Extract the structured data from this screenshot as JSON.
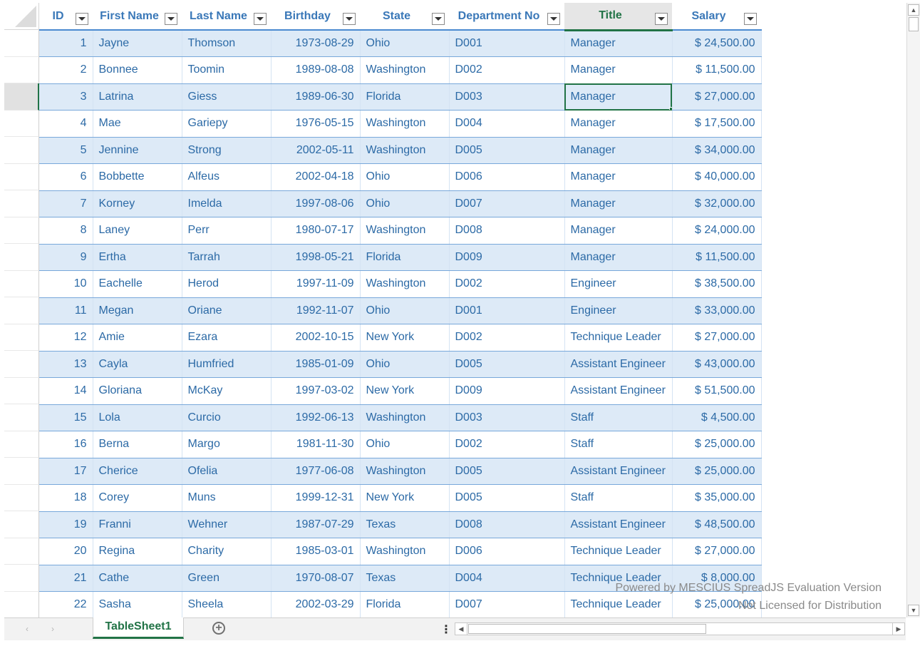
{
  "table": {
    "columns": [
      {
        "key": "id",
        "label": "ID"
      },
      {
        "key": "first",
        "label": "First Name"
      },
      {
        "key": "last",
        "label": "Last Name"
      },
      {
        "key": "birthday",
        "label": "Birthday"
      },
      {
        "key": "state",
        "label": "State"
      },
      {
        "key": "dept",
        "label": "Department No"
      },
      {
        "key": "title",
        "label": "Title"
      },
      {
        "key": "salary",
        "label": "Salary"
      }
    ],
    "active_column": "Title",
    "selected_cell": {
      "row": 3,
      "column": "Title"
    },
    "rows": [
      [
        "1",
        "Jayne",
        "Thomson",
        "1973-08-29",
        "Ohio",
        "D001",
        "Manager",
        "$ 24,500.00"
      ],
      [
        "2",
        "Bonnee",
        "Toomin",
        "1989-08-08",
        "Washington",
        "D002",
        "Manager",
        "$ 11,500.00"
      ],
      [
        "3",
        "Latrina",
        "Giess",
        "1989-06-30",
        "Florida",
        "D003",
        "Manager",
        "$ 27,000.00"
      ],
      [
        "4",
        "Mae",
        "Gariepy",
        "1976-05-15",
        "Washington",
        "D004",
        "Manager",
        "$ 17,500.00"
      ],
      [
        "5",
        "Jennine",
        "Strong",
        "2002-05-11",
        "Washington",
        "D005",
        "Manager",
        "$ 34,000.00"
      ],
      [
        "6",
        "Bobbette",
        "Alfeus",
        "2002-04-18",
        "Ohio",
        "D006",
        "Manager",
        "$ 40,000.00"
      ],
      [
        "7",
        "Korney",
        "Imelda",
        "1997-08-06",
        "Ohio",
        "D007",
        "Manager",
        "$ 32,000.00"
      ],
      [
        "8",
        "Laney",
        "Perr",
        "1980-07-17",
        "Washington",
        "D008",
        "Manager",
        "$ 24,000.00"
      ],
      [
        "9",
        "Ertha",
        "Tarrah",
        "1998-05-21",
        "Florida",
        "D009",
        "Manager",
        "$ 11,500.00"
      ],
      [
        "10",
        "Eachelle",
        "Herod",
        "1997-11-09",
        "Washington",
        "D002",
        "Engineer",
        "$ 38,500.00"
      ],
      [
        "11",
        "Megan",
        "Oriane",
        "1992-11-07",
        "Ohio",
        "D001",
        "Engineer",
        "$ 33,000.00"
      ],
      [
        "12",
        "Amie",
        "Ezara",
        "2002-10-15",
        "New York",
        "D002",
        "Technique Leader",
        "$ 27,000.00"
      ],
      [
        "13",
        "Cayla",
        "Humfried",
        "1985-01-09",
        "Ohio",
        "D005",
        "Assistant Engineer",
        "$ 43,000.00"
      ],
      [
        "14",
        "Gloriana",
        "McKay",
        "1997-03-02",
        "New York",
        "D009",
        "Assistant Engineer",
        "$ 51,500.00"
      ],
      [
        "15",
        "Lola",
        "Curcio",
        "1992-06-13",
        "Washington",
        "D003",
        "Staff",
        "$ 4,500.00"
      ],
      [
        "16",
        "Berna",
        "Margo",
        "1981-11-30",
        "Ohio",
        "D002",
        "Staff",
        "$ 25,000.00"
      ],
      [
        "17",
        "Cherice",
        "Ofelia",
        "1977-06-08",
        "Washington",
        "D005",
        "Assistant Engineer",
        "$ 25,000.00"
      ],
      [
        "18",
        "Corey",
        "Muns",
        "1999-12-31",
        "New York",
        "D005",
        "Staff",
        "$ 35,000.00"
      ],
      [
        "19",
        "Franni",
        "Wehner",
        "1987-07-29",
        "Texas",
        "D008",
        "Assistant Engineer",
        "$ 48,500.00"
      ],
      [
        "20",
        "Regina",
        "Charity",
        "1985-03-01",
        "Washington",
        "D006",
        "Technique Leader",
        "$ 27,000.00"
      ],
      [
        "21",
        "Cathe",
        "Green",
        "1970-08-07",
        "Texas",
        "D004",
        "Technique Leader",
        "$ 8,000.00"
      ],
      [
        "22",
        "Sasha",
        "Sheela",
        "2002-03-29",
        "Florida",
        "D007",
        "Technique Leader",
        "$ 25,000.00"
      ]
    ]
  },
  "watermark": {
    "line1": "Powered by MESCIUS SpreadJS Evaluation Version",
    "line2": "Not Licensed for Distribution"
  },
  "tabbar": {
    "sheet_tab": "TableSheet1",
    "nav_prev_icon": "‹",
    "nav_next_icon": "›",
    "add_icon": "+",
    "splitter_icon": "⋮"
  },
  "icons": {
    "filter": "filter-dropdown-icon",
    "add_sheet": "plus-circle-icon",
    "scroll_up": "▲",
    "scroll_down": "▼",
    "scroll_left": "◀",
    "scroll_right": "▶"
  },
  "colors": {
    "accent_green": "#217346",
    "band_blue": "#ddeaf7",
    "header_text_blue": "#3a78b8",
    "cell_text_blue": "#2c6aa6"
  }
}
